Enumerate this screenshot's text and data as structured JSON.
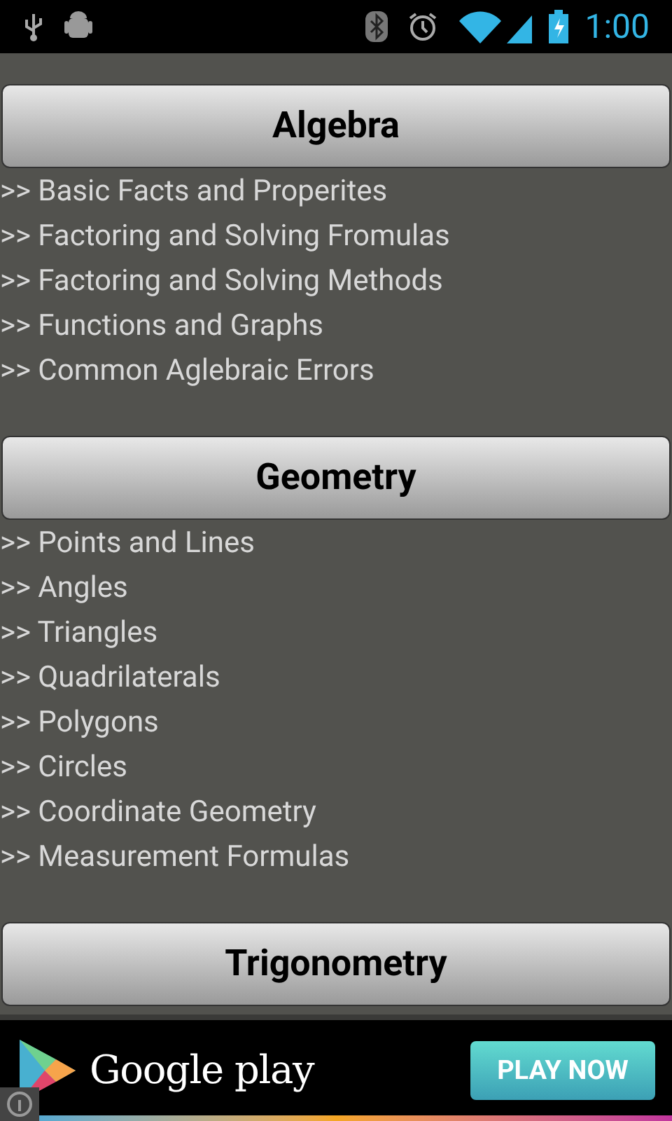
{
  "status_bar": {
    "time": "1:00"
  },
  "sections": [
    {
      "title": "Algebra",
      "items": [
        ">> Basic Facts and Properites",
        ">> Factoring and Solving Fromulas",
        ">> Factoring and Solving Methods",
        ">> Functions and Graphs",
        ">> Common Aglebraic Errors"
      ]
    },
    {
      "title": "Geometry",
      "items": [
        ">> Points and Lines",
        ">> Angles",
        ">> Triangles",
        ">> Quadrilaterals",
        ">> Polygons",
        ">> Circles",
        ">> Coordinate Geometry",
        ">> Measurement Formulas"
      ]
    },
    {
      "title": "Trigonometry"
    }
  ],
  "ad": {
    "brand": "Google play",
    "button": "PLAY NOW"
  }
}
